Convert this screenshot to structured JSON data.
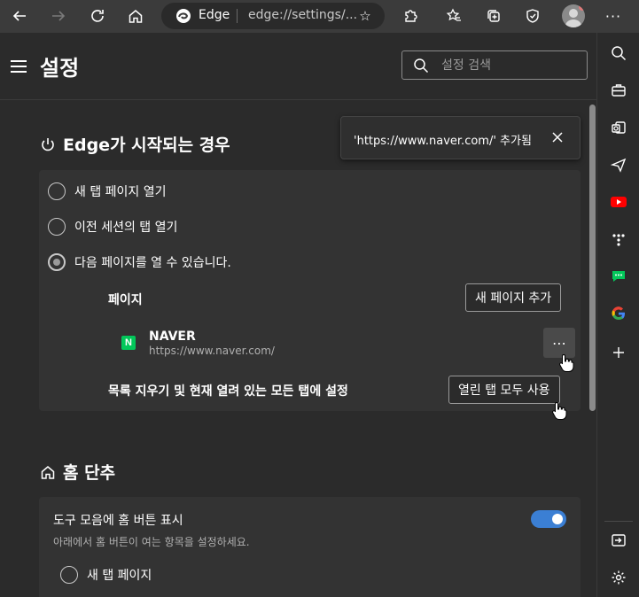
{
  "toolbar": {
    "site_label": "Edge",
    "url": "edge://settings/..."
  },
  "header": {
    "title": "설정",
    "search_placeholder": "설정 검색"
  },
  "toast": {
    "message": "'https://www.naver.com/' 추가됨"
  },
  "startup": {
    "title": "Edge가 시작되는 경우",
    "options": [
      {
        "label": "새 탭 페이지 열기",
        "checked": false
      },
      {
        "label": "이전 세션의 탭 열기",
        "checked": false
      },
      {
        "label": "다음 페이지를 열 수 있습니다.",
        "checked": true
      }
    ],
    "pages_label": "페이지",
    "add_page_button": "새 페이지 추가",
    "page_item": {
      "logo_letter": "N",
      "name": "NAVER",
      "url": "https://www.naver.com/"
    },
    "more_button": "⋯",
    "clear_label": "목록 지우기 및 현재 열려 있는 모든 탭에 설정",
    "use_all_tabs_button": "열린 탭 모두 사용"
  },
  "home": {
    "title": "홈 단추",
    "toggle_label": "도구 모음에 홈 버튼 표시",
    "toggle_on": true,
    "sub_text": "아래에서 홈 버튼이 여는 항목을 설정하세요.",
    "option_new_tab": "새 탭 페이지"
  },
  "colors": {
    "accent": "#3b7fd4",
    "naver_green": "#03c75a",
    "youtube_red": "#ff0000"
  }
}
